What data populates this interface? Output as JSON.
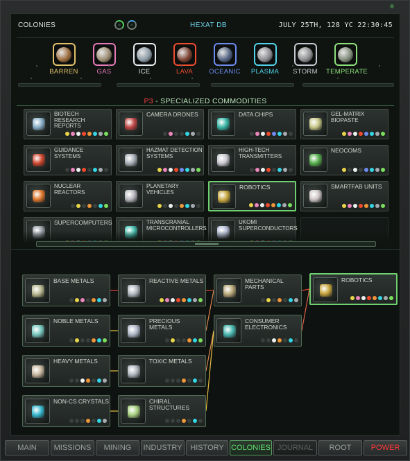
{
  "header": {
    "section": "COLONIES",
    "db": "HEXAT DB",
    "datetime": "JULY 25TH, 128 YC   22:30:45"
  },
  "planets": [
    {
      "label": "BARREN",
      "color": "#e2c26a",
      "ball": "#9a6a3a"
    },
    {
      "label": "GAS",
      "color": "#e67ab8",
      "ball": "#9a8a70"
    },
    {
      "label": "ICE",
      "color": "#e6ecef",
      "ball": "#8a9aa4"
    },
    {
      "label": "LAVA",
      "color": "#f04c30",
      "ball": "#7a4030"
    },
    {
      "label": "OCEANIC",
      "color": "#6e8cf0",
      "ball": "#506080"
    },
    {
      "label": "PLASMA",
      "color": "#52d4e8",
      "ball": "#8a8a90"
    },
    {
      "label": "STORM",
      "color": "#c4c8cc",
      "ball": "#8a8c8e"
    },
    {
      "label": "TEMPERATE",
      "color": "#8de07a",
      "ball": "#808a78"
    }
  ],
  "section_title": {
    "tier": "P3",
    "rest": " - SPECIALIZED COMMODITIES"
  },
  "palette": {
    "yellow": "#e8d64a",
    "pink": "#ec86bc",
    "white": "#eef0f0",
    "red": "#f04a2c",
    "blue": "#6f8cf0",
    "cyan": "#34d6e6",
    "gray": "#a6abb0",
    "green": "#7adf5c",
    "orange": "#f0963a",
    "off": "#3a403d"
  },
  "commodities": [
    {
      "name": "BIOTECH RESEARCH REPORTS",
      "icon": "report-icon",
      "glyph": "#8ab0c8",
      "dots": [
        "yellow",
        "pink",
        "white",
        "red",
        "orange",
        "cyan",
        "gray",
        "green"
      ]
    },
    {
      "name": "CAMERA DRONES",
      "icon": "drone-icon",
      "glyph": "#c04848",
      "dots": [
        "off",
        "pink",
        "off",
        "off",
        "cyan",
        "gray",
        "off"
      ]
    },
    {
      "name": "DATA CHIPS",
      "icon": "chip-icon",
      "glyph": "#3ab8a8",
      "dots": [
        "off",
        "pink",
        "white",
        "red",
        "blue",
        "cyan",
        "gray",
        "off"
      ]
    },
    {
      "name": "GEL-MATRIX BIOPASTE",
      "icon": "biopaste-icon",
      "glyph": "#c8c888",
      "dots": [
        "yellow",
        "pink",
        "white",
        "red",
        "blue",
        "cyan",
        "gray",
        "green"
      ]
    },
    {
      "name": "GUIDANCE SYSTEMS",
      "icon": "guidance-icon",
      "glyph": "#d04830",
      "dots": [
        "off",
        "pink",
        "white",
        "red",
        "off",
        "cyan",
        "gray",
        "off"
      ]
    },
    {
      "name": "HAZMAT DETECTION SYSTEMS",
      "icon": "hazmat-icon",
      "glyph": "#a8b0b8",
      "dots": [
        "yellow",
        "pink",
        "white",
        "red",
        "blue",
        "cyan",
        "gray",
        "green"
      ]
    },
    {
      "name": "HIGH-TECH TRANSMITTERS",
      "icon": "transmitter-icon",
      "glyph": "#c8c8d0",
      "dots": [
        "off",
        "pink",
        "white",
        "red",
        "off",
        "cyan",
        "gray",
        "off"
      ]
    },
    {
      "name": "NEOCOMS",
      "icon": "neocom-icon",
      "glyph": "#58b050",
      "dots": [
        "yellow",
        "off",
        "white",
        "off",
        "blue",
        "cyan",
        "gray",
        "green"
      ]
    },
    {
      "name": "NUCLEAR REACTORS",
      "icon": "reactor-icon",
      "glyph": "#e07a30",
      "dots": [
        "off",
        "yellow",
        "off",
        "orange",
        "off",
        "cyan",
        "green"
      ]
    },
    {
      "name": "PLANETARY VEHICLES",
      "icon": "vehicle-icon",
      "glyph": "#b8b8c0",
      "dots": [
        "yellow",
        "off",
        "white",
        "off",
        "orange",
        "cyan",
        "gray",
        "off"
      ]
    },
    {
      "name": "ROBOTICS",
      "icon": "robotics-icon",
      "glyph": "#c8a840",
      "dots": [
        "yellow",
        "pink",
        "white",
        "red",
        "orange",
        "cyan",
        "gray",
        "green"
      ],
      "selected": true
    },
    {
      "name": "SMARTFAB UNITS",
      "icon": "smartfab-icon",
      "glyph": "#d0c8c8",
      "dots": [
        "yellow",
        "pink",
        "white",
        "red",
        "orange",
        "cyan",
        "gray",
        "green"
      ]
    },
    {
      "name": "SUPERCOMPUTERS",
      "icon": "supercomputer-icon",
      "glyph": "#9aa0a8",
      "dots": [
        "yellow",
        "pink",
        "white",
        "red",
        "blue",
        "cyan",
        "gray",
        "green"
      ]
    },
    {
      "name": "TRANSCRANIAL MICROCONTROLLERS",
      "icon": "microcontroller-icon",
      "glyph": "#48c0b0",
      "dots": [
        "yellow",
        "pink",
        "white",
        "red",
        "blue",
        "cyan",
        "gray",
        "green"
      ]
    },
    {
      "name": "UKOMI SUPERCONDUCTORS",
      "icon": "superconductor-icon",
      "glyph": "#b8c0d8",
      "dots": [
        "yellow",
        "pink",
        "white",
        "red",
        "blue",
        "cyan",
        "gray",
        "green"
      ]
    },
    {
      "name": "",
      "icon": "",
      "glyph": "",
      "dots": [],
      "empty": true
    }
  ],
  "tree": {
    "p1": [
      {
        "name": "BASE METALS",
        "icon": "base-metals-icon",
        "glyph": "#b8b890",
        "dots": [
          "off",
          "yellow",
          "pink",
          "off",
          "orange",
          "cyan",
          "gray"
        ]
      },
      {
        "name": "NOBLE METALS",
        "icon": "noble-metals-icon",
        "glyph": "#78c8c0",
        "dots": [
          "off",
          "yellow",
          "off",
          "off",
          "orange",
          "cyan",
          "green"
        ]
      },
      {
        "name": "HEAVY METALS",
        "icon": "heavy-metals-icon",
        "glyph": "#c8b8a0",
        "dots": [
          "off",
          "off",
          "white",
          "orange",
          "off",
          "cyan",
          "gray"
        ]
      },
      {
        "name": "NON-CS CRYSTALS",
        "icon": "crystals-icon",
        "glyph": "#38b8d0",
        "dots": [
          "off",
          "off",
          "off",
          "orange",
          "off",
          "cyan",
          "gray"
        ]
      }
    ],
    "p2": [
      {
        "name": "REACTIVE METALS",
        "icon": "reactive-metals-icon",
        "glyph": "#b0b8c0",
        "dots": [
          "yellow",
          "pink",
          "white",
          "red",
          "orange",
          "cyan",
          "gray",
          "green"
        ]
      },
      {
        "name": "PRECIOUS METALS",
        "icon": "precious-metals-icon",
        "glyph": "#b0b8c8",
        "dots": [
          "off",
          "yellow",
          "off",
          "off",
          "orange",
          "cyan",
          "green"
        ]
      },
      {
        "name": "TOXIC METALS",
        "icon": "toxic-metals-icon",
        "glyph": "#b0b8c0",
        "dots": [
          "off",
          "off",
          "off",
          "orange",
          "off",
          "cyan",
          "off"
        ]
      },
      {
        "name": "CHIRAL STRUCTURES",
        "icon": "chiral-icon",
        "glyph": "#a8d080",
        "dots": [
          "off",
          "off",
          "off",
          "orange",
          "off",
          "cyan",
          "off"
        ]
      }
    ],
    "p3": [
      {
        "name": "MECHANICAL PARTS",
        "icon": "mechanical-parts-icon",
        "glyph": "#b8a878",
        "dots": [
          "off",
          "yellow",
          "off",
          "orange",
          "off",
          "cyan",
          "gray"
        ]
      },
      {
        "name": "CONSUMER ELECTRONICS",
        "icon": "electronics-icon",
        "glyph": "#48b8b0",
        "dots": [
          "off",
          "off",
          "white",
          "orange",
          "off",
          "cyan",
          "off"
        ]
      }
    ],
    "p4": [
      {
        "name": "ROBOTICS",
        "icon": "robotics-icon",
        "glyph": "#c8a840",
        "dots": [
          "yellow",
          "pink",
          "white",
          "red",
          "orange",
          "cyan",
          "gray",
          "green"
        ]
      }
    ]
  },
  "tabs": [
    {
      "label": "MAIN",
      "state": "normal"
    },
    {
      "label": "MISSIONS",
      "state": "normal"
    },
    {
      "label": "MINING",
      "state": "normal"
    },
    {
      "label": "INDUSTRY",
      "state": "normal"
    },
    {
      "label": "HISTORY",
      "state": "normal"
    },
    {
      "label": "COLONIES",
      "state": "active"
    },
    {
      "label": "JOURNAL",
      "state": "dim"
    },
    {
      "label": "ROOT",
      "state": "normal"
    },
    {
      "label": "POWER",
      "state": "power"
    }
  ]
}
